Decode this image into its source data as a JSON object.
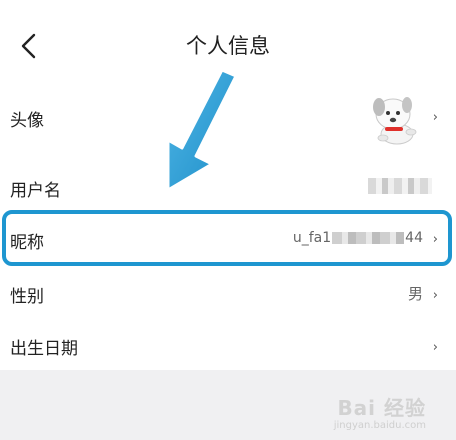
{
  "header": {
    "title": "个人信息"
  },
  "rows": {
    "avatar": {
      "label": "头像"
    },
    "username": {
      "label": "用户名"
    },
    "nickname": {
      "label": "昵称",
      "value_prefix": "u_fa1",
      "value_suffix": "44"
    },
    "gender": {
      "label": "性别",
      "value": "男"
    },
    "birthday": {
      "label": "出生日期"
    }
  },
  "chevron": "›",
  "watermark": {
    "text": "Bai 经验",
    "sub": "jingyan.baidu.com"
  },
  "colors": {
    "highlight": "#1e96d0",
    "arrow": "#1e96d0"
  }
}
